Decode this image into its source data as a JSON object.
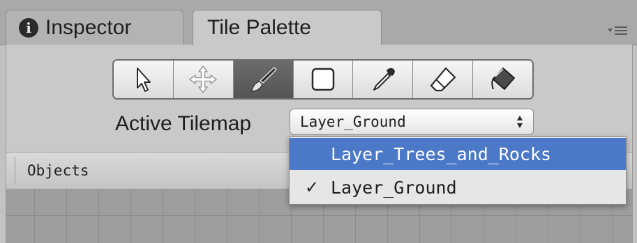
{
  "tabs": {
    "inspector_label": "Inspector",
    "tile_palette_label": "Tile Palette",
    "info_glyph": "i"
  },
  "toolbar": {
    "tools": [
      {
        "icon": "select-arrow-icon",
        "active": false
      },
      {
        "icon": "move-arrows-icon",
        "active": false
      },
      {
        "icon": "paintbrush-icon",
        "active": true
      },
      {
        "icon": "box-fill-icon",
        "active": false
      },
      {
        "icon": "eyedropper-icon",
        "active": false
      },
      {
        "icon": "eraser-icon",
        "active": false
      },
      {
        "icon": "flood-fill-icon",
        "active": false
      }
    ]
  },
  "active_tilemap": {
    "label": "Active Tilemap",
    "selected_value": "Layer_Ground"
  },
  "dropdown": {
    "options": [
      {
        "label": "Layer_Trees_and_Rocks",
        "highlighted": true,
        "checked": false
      },
      {
        "label": "Layer_Ground",
        "highlighted": false,
        "checked": true
      }
    ],
    "check_glyph": "✓"
  },
  "objects_header": {
    "label": "Objects"
  },
  "colors": {
    "highlight": "#4b79c8",
    "active_tool": "#5c5c5c"
  }
}
